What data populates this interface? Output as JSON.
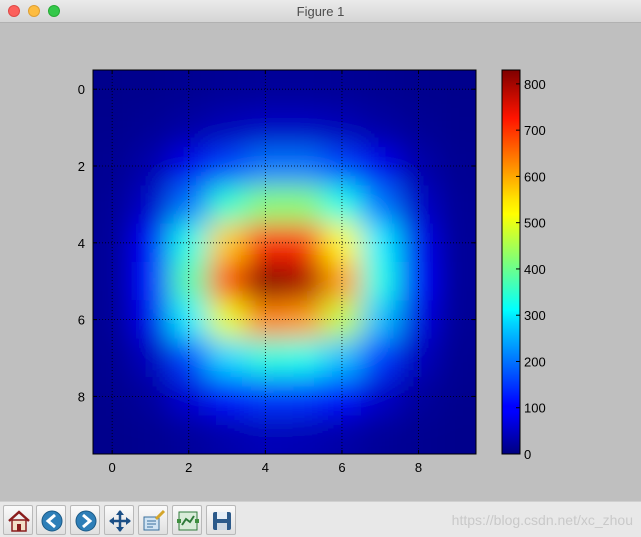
{
  "window": {
    "title": "Figure 1"
  },
  "toolbar": {
    "buttons": [
      {
        "name": "home",
        "icon": "home-icon"
      },
      {
        "name": "back",
        "icon": "back-arrow-icon"
      },
      {
        "name": "forward",
        "icon": "forward-arrow-icon"
      },
      {
        "name": "pan",
        "icon": "move-icon"
      },
      {
        "name": "zoom",
        "icon": "zoom-rect-icon"
      },
      {
        "name": "configure-subplots",
        "icon": "subplots-icon"
      },
      {
        "name": "save",
        "icon": "save-icon"
      }
    ]
  },
  "watermark": "https://blog.csdn.net/xc_zhou",
  "chart_data": {
    "type": "heatmap",
    "colormap": "jet",
    "grid": true,
    "x_ticks": [
      "0",
      "2",
      "4",
      "6",
      "8"
    ],
    "y_ticks": [
      "0",
      "2",
      "4",
      "6",
      "8"
    ],
    "xlim": [
      -0.5,
      9.5
    ],
    "ylim": [
      9.5,
      -0.5
    ],
    "colorbar": {
      "range": [
        0,
        830
      ],
      "ticks": [
        "0",
        "100",
        "200",
        "300",
        "400",
        "500",
        "600",
        "700",
        "800"
      ]
    },
    "values": [
      [
        10,
        12,
        15,
        18,
        20,
        20,
        18,
        15,
        12,
        10
      ],
      [
        12,
        18,
        30,
        45,
        55,
        55,
        45,
        30,
        18,
        12
      ],
      [
        15,
        35,
        90,
        160,
        200,
        200,
        160,
        90,
        35,
        15
      ],
      [
        18,
        60,
        200,
        350,
        420,
        420,
        330,
        200,
        60,
        18
      ],
      [
        20,
        100,
        330,
        560,
        700,
        680,
        520,
        300,
        90,
        20
      ],
      [
        20,
        110,
        380,
        660,
        830,
        800,
        600,
        330,
        100,
        20
      ],
      [
        18,
        90,
        300,
        500,
        620,
        600,
        470,
        260,
        80,
        18
      ],
      [
        15,
        50,
        160,
        280,
        340,
        330,
        260,
        150,
        50,
        15
      ],
      [
        12,
        25,
        70,
        120,
        150,
        145,
        110,
        60,
        25,
        12
      ],
      [
        10,
        14,
        22,
        35,
        45,
        42,
        32,
        20,
        14,
        10
      ]
    ]
  }
}
